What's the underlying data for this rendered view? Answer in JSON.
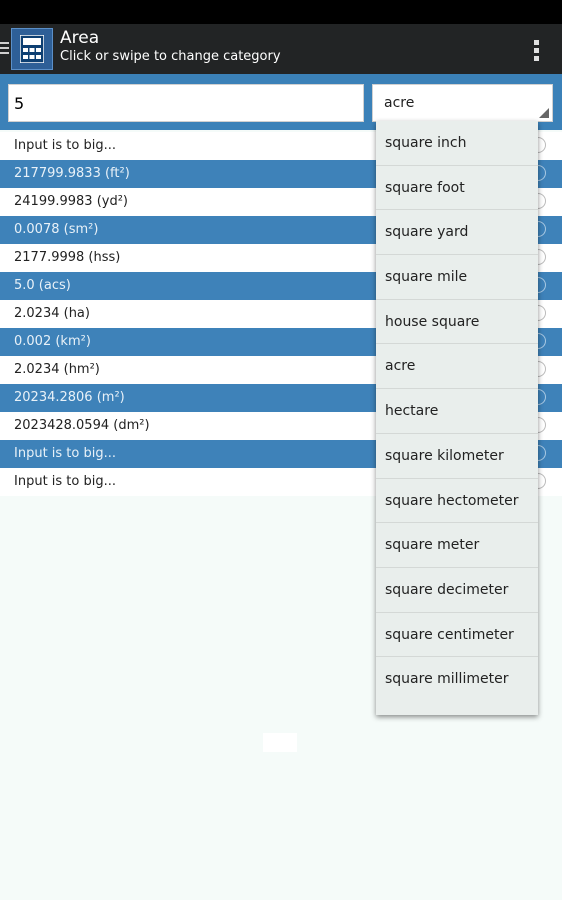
{
  "app": {
    "title": "Area",
    "subtitle": "Click or swipe to change category"
  },
  "input": {
    "value": "5"
  },
  "unit_select": {
    "selected": "acre"
  },
  "results": [
    "Input is to big...",
    "217799.9833 (ft²)",
    "24199.9983 (yd²)",
    "0.0078 (sm²)",
    "2177.9998 (hss)",
    "5.0 (acs)",
    "2.0234 (ha)",
    "0.002 (km²)",
    "2.0234 (hm²)",
    "20234.2806 (m²)",
    "2023428.0594 (dm²)",
    "Input is to big...",
    "Input is to big..."
  ],
  "dropdown": {
    "options": [
      "square inch",
      "square foot",
      "square yard",
      "square mile",
      "house square",
      "acre",
      "hectare",
      "square kilometer",
      "square hectometer",
      "square meter",
      "square decimeter",
      "square centimeter",
      "square millimeter"
    ]
  },
  "colors": {
    "accent": "#3b81b8",
    "app_bar": "#222425",
    "background": "#f5fbf9"
  }
}
